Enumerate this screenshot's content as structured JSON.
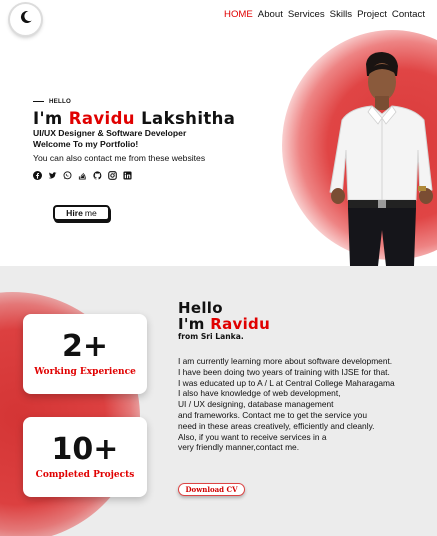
{
  "nav": {
    "items": [
      {
        "label": "HOME",
        "active": true
      },
      {
        "label": "About",
        "active": false
      },
      {
        "label": "Services",
        "active": false
      },
      {
        "label": "Skills",
        "active": false
      },
      {
        "label": "Project",
        "active": false
      },
      {
        "label": "Contact",
        "active": false
      }
    ]
  },
  "theme_toggle": {
    "icon": "moon-icon"
  },
  "hero": {
    "hello": "HELLO",
    "name_prefix": "I'm",
    "name_highlight": "Ravidu",
    "name_suffix": "Lakshitha",
    "role": "UI/UX Designer & Software Developer",
    "welcome": "Welcome To my Portfolio!",
    "contact_text": "You can also contact me from these websites",
    "socials": [
      "facebook-icon",
      "twitter-icon",
      "whatsapp-icon",
      "stack-overflow-icon",
      "github-icon",
      "instagram-icon",
      "linkedin-icon"
    ],
    "hire_label": "Hire",
    "hire_label_suffix": "me"
  },
  "about": {
    "stats": [
      {
        "number": "2+",
        "label": "Working Experience"
      },
      {
        "number": "10+",
        "label": "Completed Projects"
      }
    ],
    "heading_hello": "Hello",
    "heading_name_prefix": "I'm",
    "heading_name_highlight": "Ravidu",
    "heading_from": "from Sri Lanka.",
    "paragraph_lines": [
      "I am currently learning more about software development.",
      "I have been doing two years of training with IJSE for that.",
      "I was educated up to A / L at Central College Maharagama",
      "I also have knowledge of web development,",
      "UI / UX designing, database management",
      "and frameworks. Contact me to get the service you",
      "need in these areas creatively, efficiently and cleanly.",
      "Also, if you want to receive services in a",
      "very friendly manner,contact me."
    ],
    "download_label": "Download CV"
  },
  "colors": {
    "accent": "#e00000",
    "about_bg": "#ececec"
  }
}
